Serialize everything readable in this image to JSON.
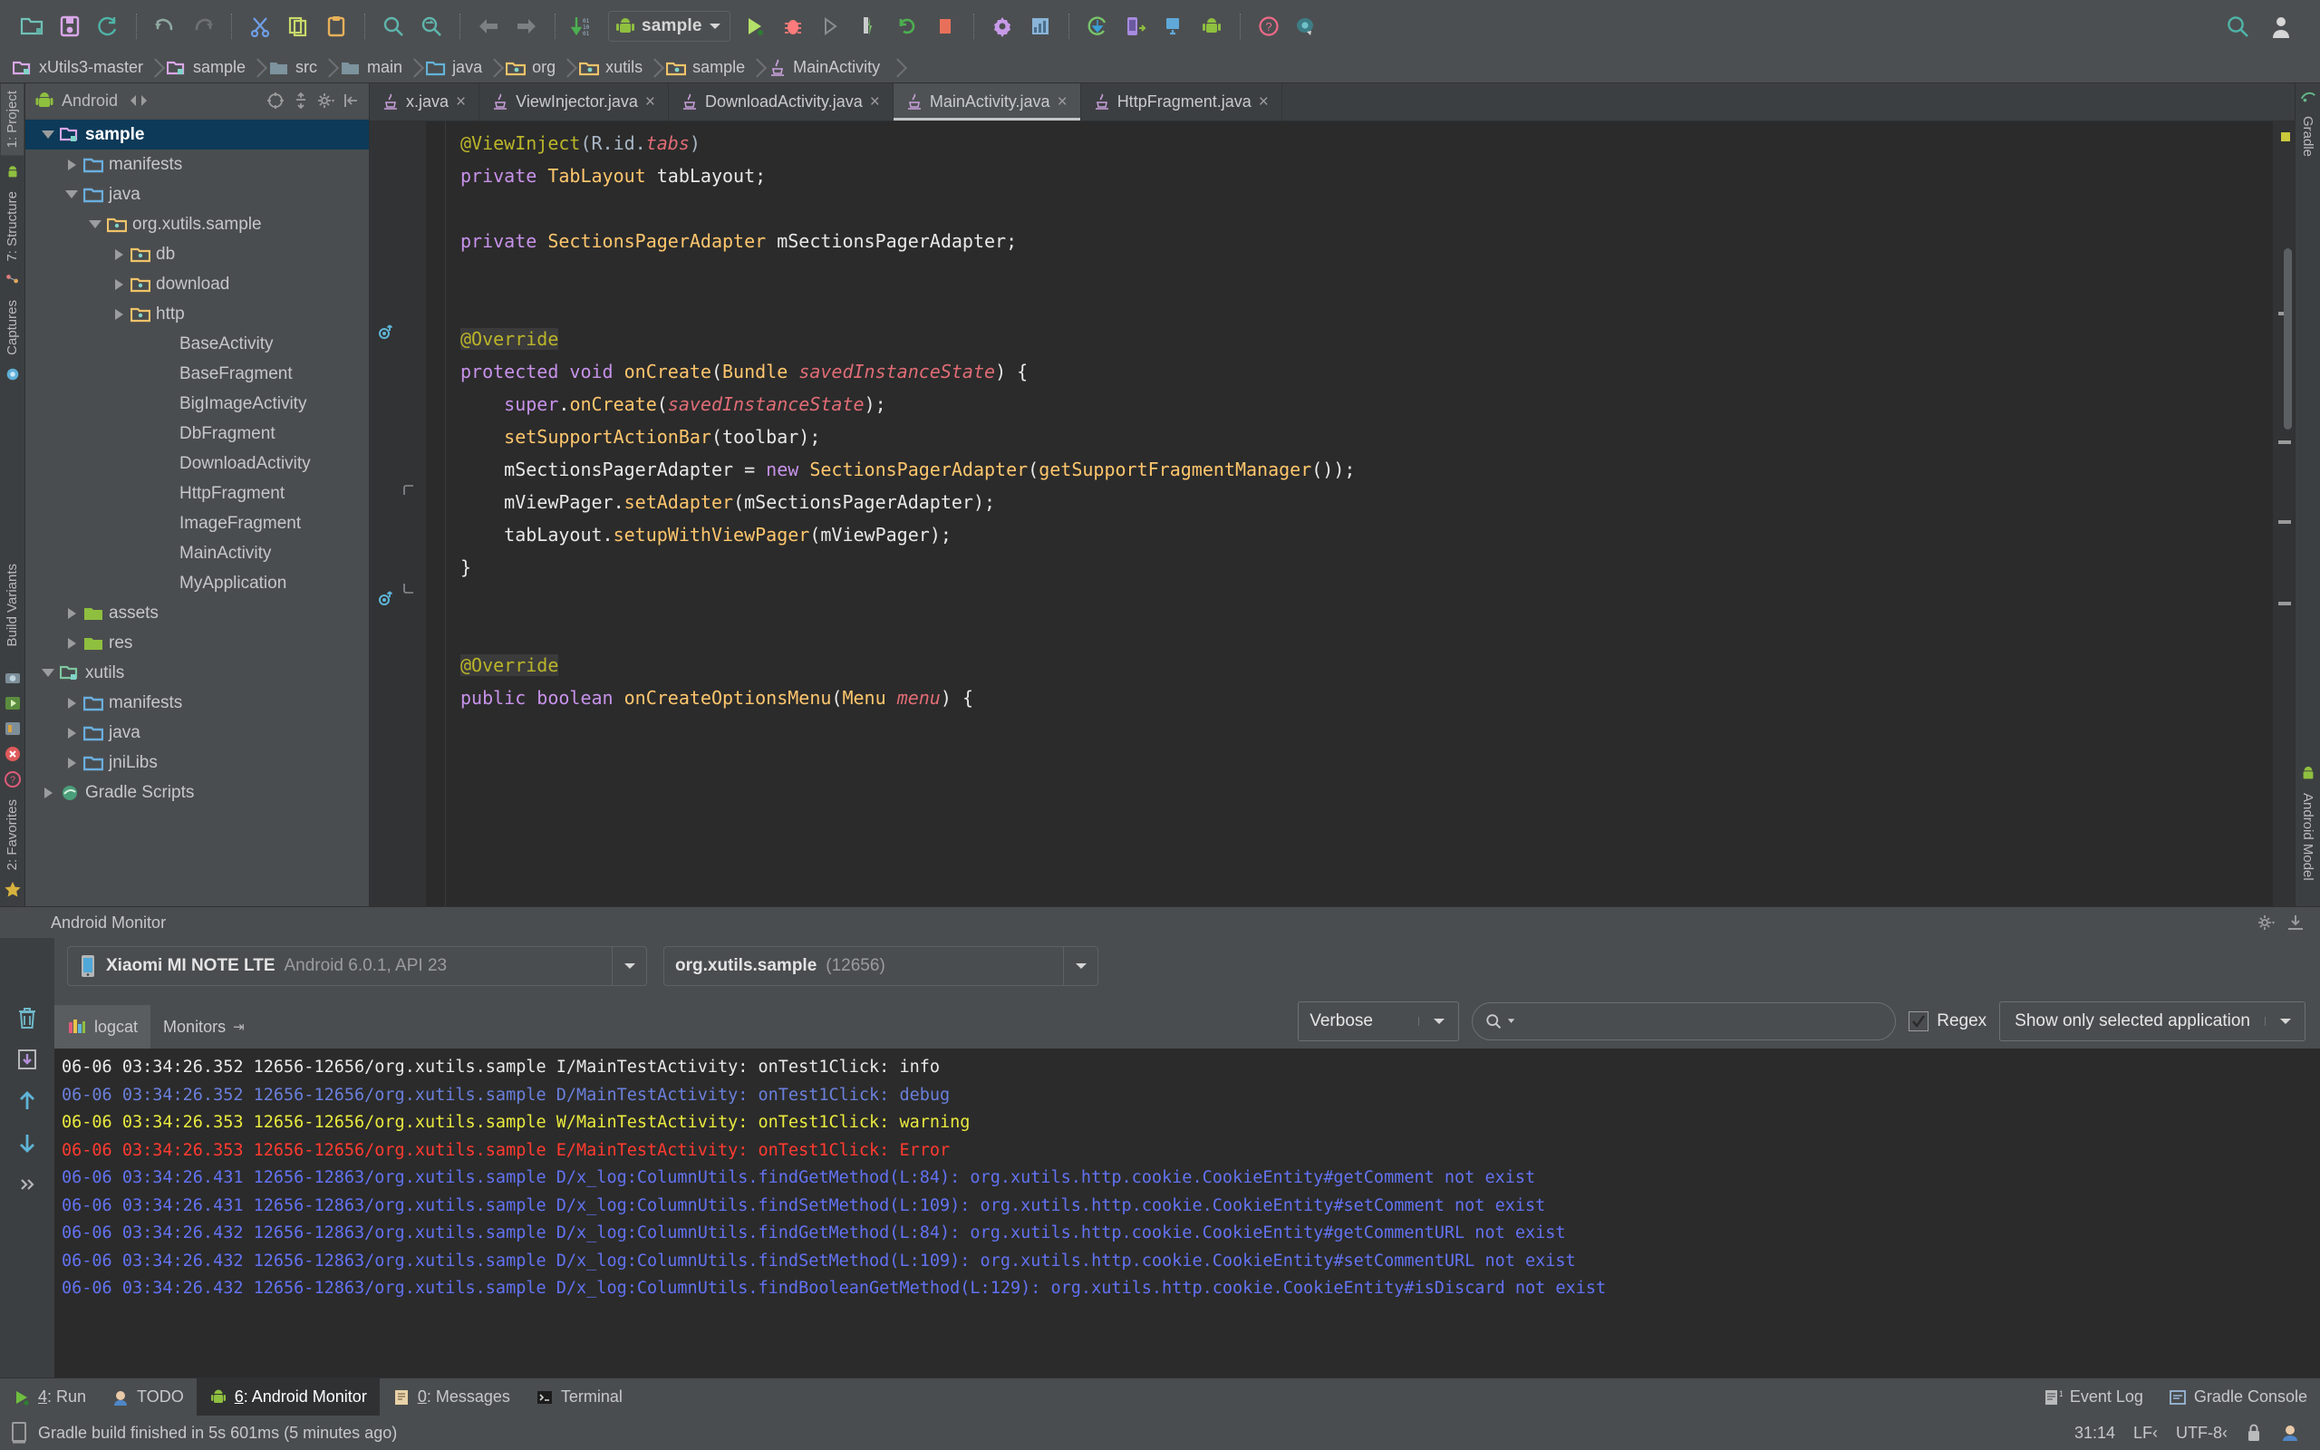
{
  "toolbar": {
    "icons": [
      {
        "name": "open-folder-icon",
        "glyph": "folder",
        "color": "#6fc2b8"
      },
      {
        "name": "save-all-icon",
        "glyph": "save",
        "color": "#d9a7e8"
      },
      {
        "name": "sync-icon",
        "glyph": "sync",
        "color": "#4fb3a8"
      },
      {
        "name": "undo-icon",
        "glyph": "undo",
        "color": "#8fa8a0"
      },
      {
        "name": "redo-icon",
        "glyph": "redo",
        "color": "#6e7173"
      },
      {
        "name": "cut-icon",
        "glyph": "cut",
        "color": "#6f9fe8"
      },
      {
        "name": "copy-icon",
        "glyph": "copy",
        "color": "#c9d96a"
      },
      {
        "name": "paste-icon",
        "glyph": "paste",
        "color": "#e8b15a"
      },
      {
        "name": "find-icon",
        "glyph": "search",
        "color": "#5fb5ad"
      },
      {
        "name": "replace-icon",
        "glyph": "replace",
        "color": "#5fb5ad"
      },
      {
        "name": "back-icon",
        "glyph": "arrow-left",
        "color": "#7d8083"
      },
      {
        "name": "forward-icon",
        "glyph": "arrow-right",
        "color": "#7d8083"
      },
      {
        "name": "compile-icon",
        "glyph": "compile",
        "color": "#4caf50"
      }
    ],
    "run_config_label": "sample",
    "right_icons": [
      {
        "name": "run-icon",
        "glyph": "play",
        "color": "#b4e06a"
      },
      {
        "name": "debug-icon",
        "glyph": "bug",
        "color": "#ff7b7b"
      },
      {
        "name": "run-step-icon",
        "glyph": "play-outline",
        "color": "#8a8d8f"
      },
      {
        "name": "instant-run-icon",
        "glyph": "instant",
        "color": "#b8bcbe"
      },
      {
        "name": "rerun-icon",
        "glyph": "rerun",
        "color": "#4caf50"
      },
      {
        "name": "stop-icon",
        "glyph": "stop",
        "color": "#e8705a"
      },
      {
        "name": "settings-icon",
        "glyph": "gear",
        "color": "#c79ae8"
      },
      {
        "name": "project-structure-icon",
        "glyph": "structure",
        "color": "#8ab4d8"
      },
      {
        "name": "sync-gradle-icon",
        "glyph": "gradle-sync",
        "color": "#79c46a"
      },
      {
        "name": "avd-manager-icon",
        "glyph": "avd",
        "color": "#a78be0"
      },
      {
        "name": "sdk-manager-icon",
        "glyph": "sdk",
        "color": "#5fa8d8"
      },
      {
        "name": "android-device-icon",
        "glyph": "android",
        "color": "#8fbf3f"
      },
      {
        "name": "help-icon",
        "glyph": "help",
        "color": "#f06a8a"
      },
      {
        "name": "search-everywhere-icon",
        "glyph": "search-circle",
        "color": "#3d7c86"
      },
      {
        "name": "global-search-icon",
        "glyph": "search",
        "color": "#4fb3a8"
      },
      {
        "name": "account-icon",
        "glyph": "avatar",
        "color": "#d6d6d6"
      }
    ]
  },
  "breadcrumb": [
    {
      "label": "xUtils3-master",
      "icon": "module-folder-icon",
      "color": "#d9a7e8"
    },
    {
      "label": "sample",
      "icon": "module-folder-icon",
      "color": "#d9a7e8"
    },
    {
      "label": "src",
      "icon": "folder-icon",
      "color": "#7d939e"
    },
    {
      "label": "main",
      "icon": "folder-icon",
      "color": "#7d939e"
    },
    {
      "label": "java",
      "icon": "source-folder-icon",
      "color": "#63b3d8"
    },
    {
      "label": "org",
      "icon": "package-icon",
      "color": "#f0c36a"
    },
    {
      "label": "xutils",
      "icon": "package-icon",
      "color": "#f0c36a"
    },
    {
      "label": "sample",
      "icon": "package-icon",
      "color": "#f0c36a"
    },
    {
      "label": "MainActivity",
      "icon": "java-class-icon",
      "color": "#c9a0dc"
    }
  ],
  "left_rail": [
    {
      "label": "1: Project",
      "icon": "project-icon",
      "selected": true
    },
    {
      "label": "7: Structure",
      "icon": "structure-icon",
      "selected": false
    },
    {
      "label": "Captures",
      "icon": "captures-icon",
      "selected": false
    }
  ],
  "left_rail_bottom": [
    {
      "label": "Build Variants",
      "icon": "build-variants-icon"
    },
    {
      "label": "2: Favorites",
      "icon": "favorites-icon"
    }
  ],
  "right_rail": [
    {
      "label": "Gradle",
      "icon": "gradle-icon"
    },
    {
      "label": "Android Model",
      "icon": "android-model-icon"
    }
  ],
  "project": {
    "title": "Android",
    "title_icon": "android-icon",
    "header_tools": [
      {
        "name": "collapse-all-icon"
      },
      {
        "name": "expand-collapse-icon"
      },
      {
        "name": "settings-gear-icon"
      },
      {
        "name": "hide-panel-icon"
      }
    ],
    "tree": [
      {
        "label": "sample",
        "depth": 0,
        "arrow": "open",
        "icon": "module-folder-icon",
        "color": "#d9a7e8",
        "selected": true
      },
      {
        "label": "manifests",
        "depth": 1,
        "arrow": "closed",
        "icon": "folder-icon",
        "color": "#6aaede",
        "selected": false
      },
      {
        "label": "java",
        "depth": 1,
        "arrow": "open",
        "icon": "folder-icon",
        "color": "#6aaede",
        "selected": false
      },
      {
        "label": "org.xutils.sample",
        "depth": 2,
        "arrow": "open",
        "icon": "package-icon",
        "color": "#f0c36a",
        "selected": false
      },
      {
        "label": "db",
        "depth": 3,
        "arrow": "closed",
        "icon": "package-icon",
        "color": "#f0c36a",
        "selected": false
      },
      {
        "label": "download",
        "depth": 3,
        "arrow": "closed",
        "icon": "package-icon",
        "color": "#f0c36a",
        "selected": false
      },
      {
        "label": "http",
        "depth": 3,
        "arrow": "closed",
        "icon": "package-icon",
        "color": "#f0c36a",
        "selected": false
      },
      {
        "label": "BaseActivity",
        "depth": 4,
        "arrow": "none",
        "icon": "none",
        "color": "",
        "selected": false
      },
      {
        "label": "BaseFragment",
        "depth": 4,
        "arrow": "none",
        "icon": "none",
        "color": "",
        "selected": false
      },
      {
        "label": "BigImageActivity",
        "depth": 4,
        "arrow": "none",
        "icon": "none",
        "color": "",
        "selected": false
      },
      {
        "label": "DbFragment",
        "depth": 4,
        "arrow": "none",
        "icon": "none",
        "color": "",
        "selected": false
      },
      {
        "label": "DownloadActivity",
        "depth": 4,
        "arrow": "none",
        "icon": "none",
        "color": "",
        "selected": false
      },
      {
        "label": "HttpFragment",
        "depth": 4,
        "arrow": "none",
        "icon": "none",
        "color": "",
        "selected": false
      },
      {
        "label": "ImageFragment",
        "depth": 4,
        "arrow": "none",
        "icon": "none",
        "color": "",
        "selected": false
      },
      {
        "label": "MainActivity",
        "depth": 4,
        "arrow": "none",
        "icon": "none",
        "color": "",
        "selected": false
      },
      {
        "label": "MyApplication",
        "depth": 4,
        "arrow": "none",
        "icon": "none",
        "color": "",
        "selected": false
      },
      {
        "label": "assets",
        "depth": 1,
        "arrow": "closed",
        "icon": "resource-folder-icon",
        "color": "#8fbf3f",
        "selected": false
      },
      {
        "label": "res",
        "depth": 1,
        "arrow": "closed",
        "icon": "resource-folder-icon",
        "color": "#8fbf3f",
        "selected": false
      },
      {
        "label": "xutils",
        "depth": 0,
        "arrow": "open",
        "icon": "module-folder-icon",
        "color": "#7ec8a0",
        "selected": false
      },
      {
        "label": "manifests",
        "depth": 1,
        "arrow": "closed",
        "icon": "folder-icon",
        "color": "#6aaede",
        "selected": false
      },
      {
        "label": "java",
        "depth": 1,
        "arrow": "closed",
        "icon": "folder-icon",
        "color": "#6aaede",
        "selected": false
      },
      {
        "label": "jniLibs",
        "depth": 1,
        "arrow": "closed",
        "icon": "folder-icon",
        "color": "#6aaede",
        "selected": false
      },
      {
        "label": "Gradle Scripts",
        "depth": 0,
        "arrow": "closed",
        "icon": "gradle-icon",
        "color": "#63b98a",
        "selected": false
      }
    ]
  },
  "editor": {
    "tabs": [
      {
        "label": "x.java",
        "active": false
      },
      {
        "label": "ViewInjector.java",
        "active": false
      },
      {
        "label": "DownloadActivity.java",
        "active": false
      },
      {
        "label": "MainActivity.java",
        "active": true
      },
      {
        "label": "HttpFragment.java",
        "active": false
      }
    ],
    "close_glyph": "×",
    "code_lines": [
      "@ViewInject(R.id.tabs)",
      "private TabLayout tabLayout;",
      "",
      "private SectionsPagerAdapter mSectionsPagerAdapter;",
      "",
      "",
      "@Override",
      "protected void onCreate(Bundle savedInstanceState) {",
      "    super.onCreate(savedInstanceState);",
      "    setSupportActionBar(toolbar);",
      "    mSectionsPagerAdapter = new SectionsPagerAdapter(getSupportFragmentManager());",
      "    mViewPager.setAdapter(mSectionsPagerAdapter);",
      "    tabLayout.setupWithViewPager(mViewPager);",
      "}",
      "",
      "",
      "@Override",
      "public boolean onCreateOptionsMenu(Menu menu) {"
    ]
  },
  "android_monitor": {
    "title": "Android Monitor",
    "device": {
      "name": "Xiaomi MI NOTE LTE",
      "sub": "Android 6.0.1, API 23",
      "icon": "device-icon"
    },
    "process": {
      "name": "org.xutils.sample",
      "sub": "(12656)"
    },
    "tabs": [
      {
        "label": "logcat",
        "icon": "logcat-icon",
        "active": true
      },
      {
        "label": "Monitors",
        "icon": "monitors-icon",
        "active": false,
        "pin": "⇥"
      }
    ],
    "left_buttons": [
      {
        "name": "clear-logcat-icon"
      },
      {
        "name": "scroll-to-end-icon"
      },
      {
        "name": "up-the-stack-icon"
      },
      {
        "name": "down-the-stack-icon"
      },
      {
        "name": "more-options-icon"
      }
    ],
    "log_level": "Verbose",
    "search_placeholder": "",
    "search_value": "",
    "regex_label": "Regex",
    "regex_checked": true,
    "filter": "Show only selected application",
    "log_lines": [
      {
        "level": "I",
        "text": "06-06 03:34:26.352 12656-12656/org.xutils.sample I/MainTestActivity: onTest1Click: info"
      },
      {
        "level": "D",
        "text": "06-06 03:34:26.352 12656-12656/org.xutils.sample D/MainTestActivity: onTest1Click: debug"
      },
      {
        "level": "W",
        "text": "06-06 03:34:26.353 12656-12656/org.xutils.sample W/MainTestActivity: onTest1Click: warning"
      },
      {
        "level": "E",
        "text": "06-06 03:34:26.353 12656-12656/org.xutils.sample E/MainTestActivity: onTest1Click: Error"
      },
      {
        "level": "D2",
        "text": "06-06 03:34:26.431 12656-12863/org.xutils.sample D/x_log:ColumnUtils.findGetMethod(L:84): org.xutils.http.cookie.CookieEntity#getComment not exist"
      },
      {
        "level": "D2",
        "text": "06-06 03:34:26.431 12656-12863/org.xutils.sample D/x_log:ColumnUtils.findSetMethod(L:109): org.xutils.http.cookie.CookieEntity#setComment not exist"
      },
      {
        "level": "D2",
        "text": "06-06 03:34:26.432 12656-12863/org.xutils.sample D/x_log:ColumnUtils.findGetMethod(L:84): org.xutils.http.cookie.CookieEntity#getCommentURL not exist"
      },
      {
        "level": "D2",
        "text": "06-06 03:34:26.432 12656-12863/org.xutils.sample D/x_log:ColumnUtils.findSetMethod(L:109): org.xutils.http.cookie.CookieEntity#setCommentURL not exist"
      },
      {
        "level": "D2",
        "text": "06-06 03:34:26.432 12656-12863/org.xutils.sample D/x_log:ColumnUtils.findBooleanGetMethod(L:129): org.xutils.http.cookie.CookieEntity#isDiscard not exist"
      }
    ]
  },
  "status_bar": {
    "items": [
      {
        "key": "4",
        "label": ": Run",
        "icon": "run-icon",
        "active": false
      },
      {
        "key": "",
        "label": "TODO",
        "icon": "todo-icon",
        "active": false
      },
      {
        "key": "6",
        "label": ": Android Monitor",
        "icon": "android-icon",
        "active": true
      },
      {
        "key": "0",
        "label": ": Messages",
        "icon": "messages-icon",
        "active": false
      },
      {
        "key": "",
        "label": "Terminal",
        "icon": "terminal-icon",
        "active": false
      }
    ],
    "right_items": [
      {
        "label": "Event Log",
        "icon": "event-log-icon",
        "badge": "1"
      },
      {
        "label": "Gradle Console",
        "icon": "gradle-console-icon",
        "badge": ""
      }
    ]
  },
  "bottom_bar": {
    "message": "Gradle build finished in 5s 601ms (5 minutes ago)",
    "caret": "31:14",
    "line_sep": "LF‹",
    "encoding": "UTF-8‹",
    "lock_icon": "lock-icon",
    "todo_icon": "todo-icon"
  }
}
